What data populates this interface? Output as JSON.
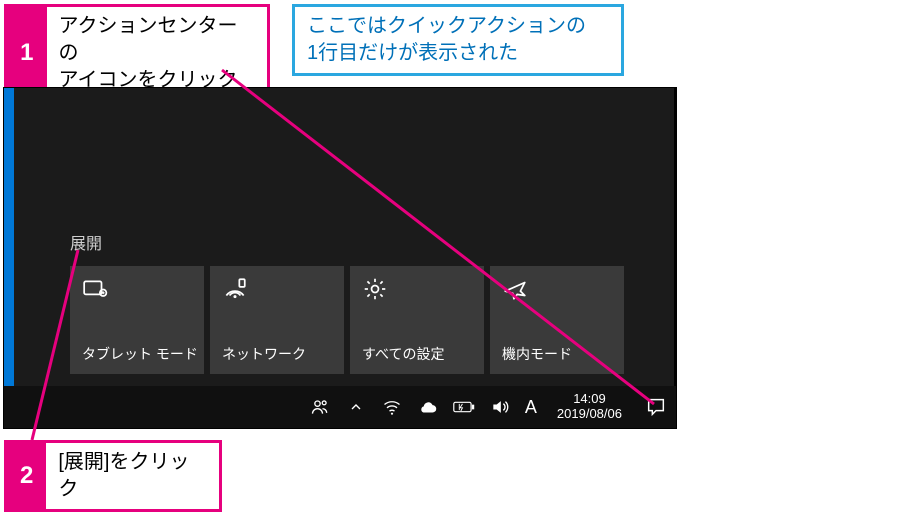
{
  "callouts": {
    "step1": {
      "num": "1",
      "text": "アクションセンターの\nアイコンをクリック"
    },
    "note": {
      "text": "ここではクイックアクションの\n1行目だけが表示された"
    },
    "step2": {
      "num": "2",
      "text": "[展開]をクリック"
    }
  },
  "action_center": {
    "expand_label": "展開",
    "tiles": [
      {
        "id": "tablet",
        "label": "タブレット モード"
      },
      {
        "id": "network",
        "label": "ネットワーク"
      },
      {
        "id": "settings",
        "label": "すべての設定"
      },
      {
        "id": "airplane",
        "label": "機内モード"
      }
    ]
  },
  "taskbar": {
    "ime": "A",
    "time": "14:09",
    "date": "2019/08/06"
  },
  "colors": {
    "magenta": "#e6007e",
    "blue": "#2aa7e0",
    "win_accent": "#0078d7"
  }
}
